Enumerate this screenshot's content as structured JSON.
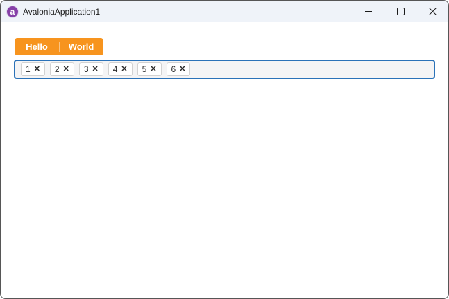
{
  "window": {
    "title": "AvaloniaApplication1"
  },
  "titlebar": {
    "logo_letter": "a",
    "icons": [
      "avalonia-logo-icon",
      "minimize-icon",
      "maximize-icon",
      "close-icon"
    ]
  },
  "tabstrip": {
    "tabs": [
      {
        "label": "Hello"
      },
      {
        "label": "World"
      }
    ]
  },
  "chipbox": {
    "close_glyph": "✕",
    "chips": [
      {
        "label": "1"
      },
      {
        "label": "2"
      },
      {
        "label": "3"
      },
      {
        "label": "4"
      },
      {
        "label": "5"
      },
      {
        "label": "6"
      }
    ]
  },
  "colors": {
    "accent_orange": "#F7941E",
    "focus_border_blue": "#2B72B8",
    "logo_purple": "#8640A8",
    "titlebar_bg": "#EFF3F9",
    "chipbox_bg": "#F4F4F5"
  }
}
